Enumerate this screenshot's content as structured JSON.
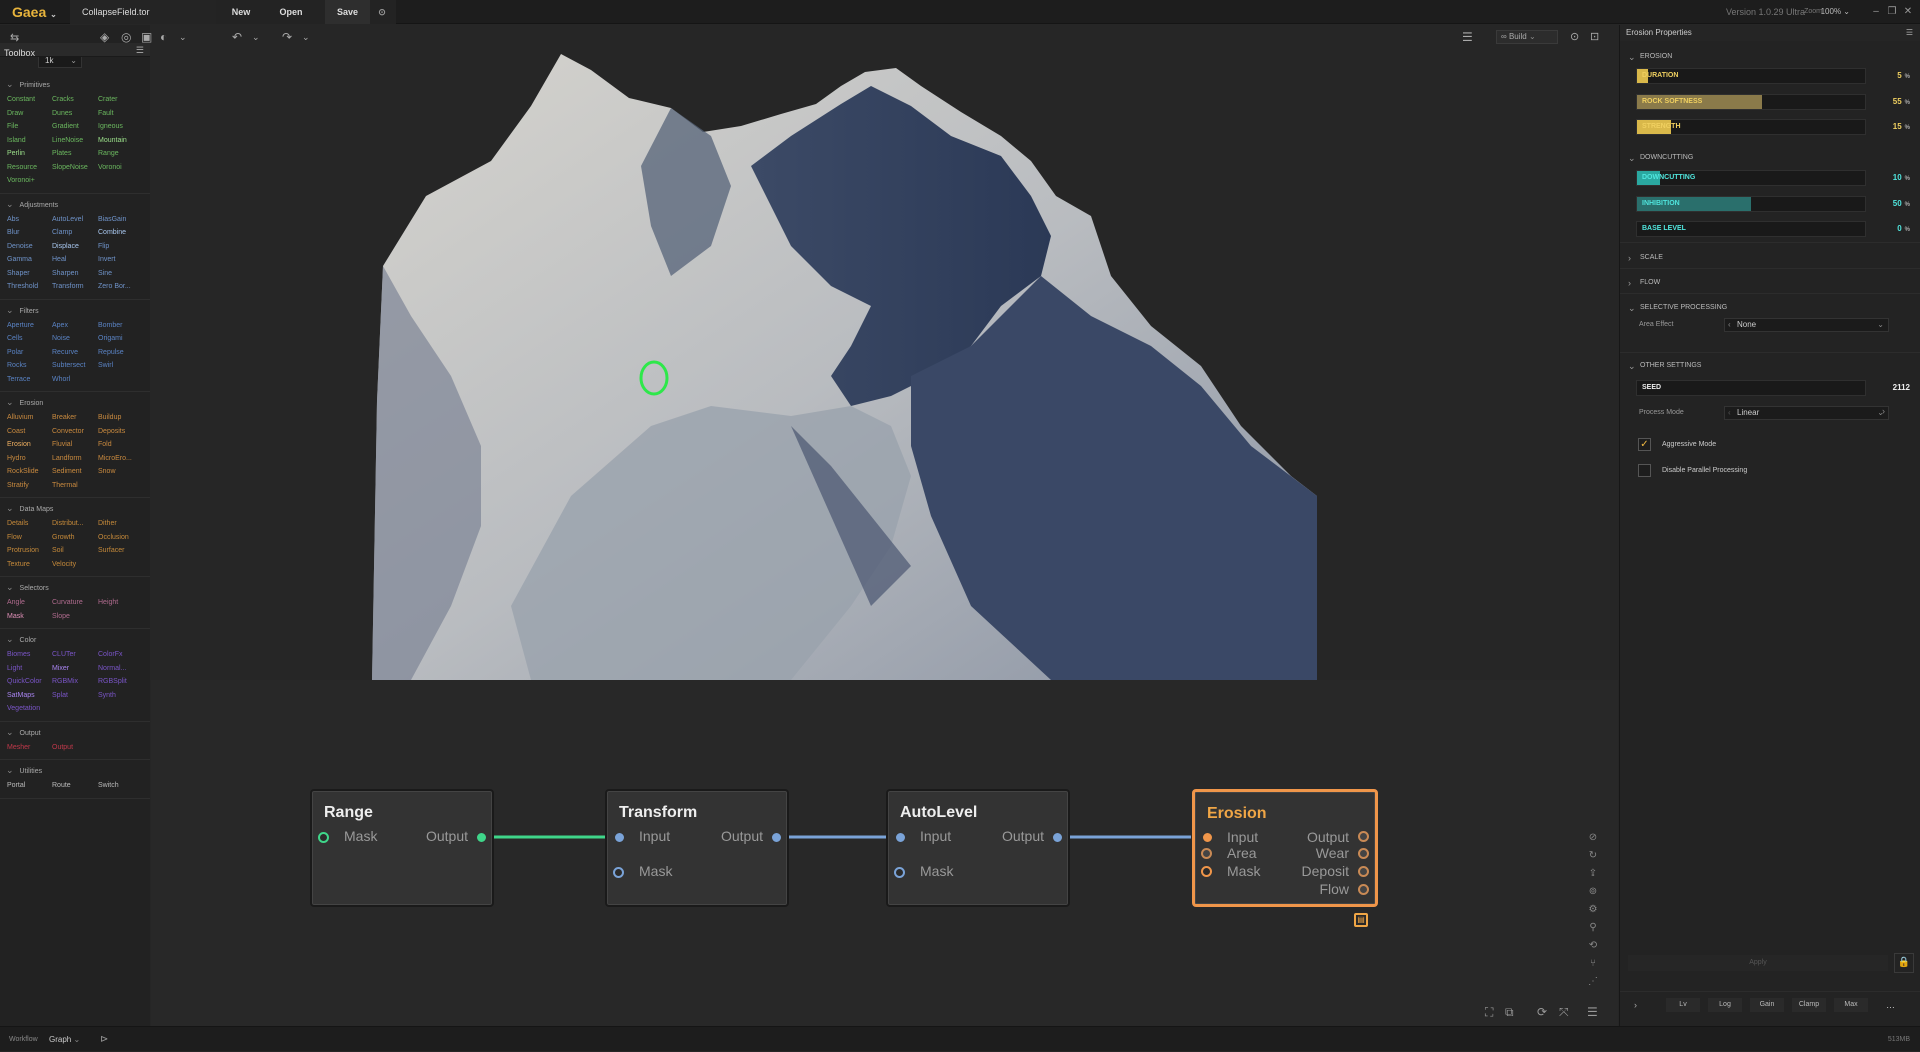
{
  "title_bar": {
    "app_name": "Gaea",
    "file_name": "CollapseField.tor",
    "menu": [
      "New",
      "Open",
      "Save"
    ],
    "version": "Version 1.0.29 Ultra",
    "zoom_label": "Zoom",
    "zoom_value": "100%"
  },
  "viewport_toolbar": {
    "resolution": "1k",
    "build_label": "Build"
  },
  "toolbox": {
    "title": "Toolbox",
    "sections": [
      {
        "name": "Primitives",
        "items": [
          {
            "label": "Constant",
            "color": "#6bb85f"
          },
          {
            "label": "Cracks",
            "color": "#6bb85f"
          },
          {
            "label": "Crater",
            "color": "#6bb85f"
          },
          {
            "label": "Draw",
            "color": "#6bb85f"
          },
          {
            "label": "Dunes",
            "color": "#6bb85f"
          },
          {
            "label": "Fault",
            "color": "#6bb85f"
          },
          {
            "label": "File",
            "color": "#6bb85f"
          },
          {
            "label": "Gradient",
            "color": "#6bb85f"
          },
          {
            "label": "Igneous",
            "color": "#6bb85f"
          },
          {
            "label": "Island",
            "color": "#6bb85f"
          },
          {
            "label": "LineNoise",
            "color": "#6bb85f"
          },
          {
            "label": "Mountain",
            "color": "#9be08a"
          },
          {
            "label": "Perlin",
            "color": "#9be08a"
          },
          {
            "label": "Plates",
            "color": "#6bb85f"
          },
          {
            "label": "Range",
            "color": "#6bb85f"
          },
          {
            "label": "Resource",
            "color": "#6bb85f"
          },
          {
            "label": "SlopeNoise",
            "color": "#6bb85f"
          },
          {
            "label": "Voronoi",
            "color": "#6bb85f"
          },
          {
            "label": "Voronoi+",
            "color": "#6bb85f"
          }
        ]
      },
      {
        "name": "Adjustments",
        "items": [
          {
            "label": "Abs",
            "color": "#6f93c9"
          },
          {
            "label": "AutoLevel",
            "color": "#6f93c9"
          },
          {
            "label": "BiasGain",
            "color": "#6f93c9"
          },
          {
            "label": "Blur",
            "color": "#6f93c9"
          },
          {
            "label": "Clamp",
            "color": "#6f93c9"
          },
          {
            "label": "Combine",
            "color": "#a9c8f0"
          },
          {
            "label": "Denoise",
            "color": "#6f93c9"
          },
          {
            "label": "Displace",
            "color": "#a9c8f0"
          },
          {
            "label": "Flip",
            "color": "#6f93c9"
          },
          {
            "label": "Gamma",
            "color": "#6f93c9"
          },
          {
            "label": "Heal",
            "color": "#6f93c9"
          },
          {
            "label": "Invert",
            "color": "#6f93c9"
          },
          {
            "label": "Shaper",
            "color": "#6f93c9"
          },
          {
            "label": "Sharpen",
            "color": "#6f93c9"
          },
          {
            "label": "Sine",
            "color": "#6f93c9"
          },
          {
            "label": "Threshold",
            "color": "#6f93c9"
          },
          {
            "label": "Transform",
            "color": "#6f93c9"
          },
          {
            "label": "Zero Bor...",
            "color": "#6f93c9"
          }
        ]
      },
      {
        "name": "Filters",
        "items": [
          {
            "label": "Aperture",
            "color": "#5a83c4"
          },
          {
            "label": "Apex",
            "color": "#5a83c4"
          },
          {
            "label": "Bomber",
            "color": "#5a83c4"
          },
          {
            "label": "Cells",
            "color": "#5a83c4"
          },
          {
            "label": "Noise",
            "color": "#5a83c4"
          },
          {
            "label": "Origami",
            "color": "#5a83c4"
          },
          {
            "label": "Polar",
            "color": "#5a83c4"
          },
          {
            "label": "Recurve",
            "color": "#5a83c4"
          },
          {
            "label": "Repulse",
            "color": "#5a83c4"
          },
          {
            "label": "Rocks",
            "color": "#5a83c4"
          },
          {
            "label": "Subtersect",
            "color": "#5a83c4"
          },
          {
            "label": "Swirl",
            "color": "#5a83c4"
          },
          {
            "label": "Terrace",
            "color": "#5a83c4"
          },
          {
            "label": "Whorl",
            "color": "#5a83c4"
          }
        ]
      },
      {
        "name": "Erosion",
        "items": [
          {
            "label": "Alluvium",
            "color": "#c98a3f"
          },
          {
            "label": "Breaker",
            "color": "#c98a3f"
          },
          {
            "label": "Buildup",
            "color": "#c98a3f"
          },
          {
            "label": "Coast",
            "color": "#c98a3f"
          },
          {
            "label": "Convector",
            "color": "#c98a3f"
          },
          {
            "label": "Deposits",
            "color": "#c98a3f"
          },
          {
            "label": "Erosion",
            "color": "#f0b060"
          },
          {
            "label": "Fluvial",
            "color": "#c98a3f"
          },
          {
            "label": "Fold",
            "color": "#c98a3f"
          },
          {
            "label": "Hydro",
            "color": "#c98a3f"
          },
          {
            "label": "Landform",
            "color": "#c98a3f"
          },
          {
            "label": "MicroEro...",
            "color": "#c98a3f"
          },
          {
            "label": "RockSlide",
            "color": "#c98a3f"
          },
          {
            "label": "Sediment",
            "color": "#c98a3f"
          },
          {
            "label": "Snow",
            "color": "#c98a3f"
          },
          {
            "label": "Stratify",
            "color": "#c98a3f"
          },
          {
            "label": "Thermal",
            "color": "#c98a3f"
          }
        ]
      },
      {
        "name": "Data Maps",
        "items": [
          {
            "label": "Details",
            "color": "#c68a3a"
          },
          {
            "label": "Distribut...",
            "color": "#c68a3a"
          },
          {
            "label": "Dither",
            "color": "#c68a3a"
          },
          {
            "label": "Flow",
            "color": "#c68a3a"
          },
          {
            "label": "Growth",
            "color": "#c68a3a"
          },
          {
            "label": "Occlusion",
            "color": "#c68a3a"
          },
          {
            "label": "Protrusion",
            "color": "#c68a3a"
          },
          {
            "label": "Soil",
            "color": "#c68a3a"
          },
          {
            "label": "Surfacer",
            "color": "#c68a3a"
          },
          {
            "label": "Texture",
            "color": "#c68a3a"
          },
          {
            "label": "Velocity",
            "color": "#c68a3a"
          }
        ]
      },
      {
        "name": "Selectors",
        "items": [
          {
            "label": "Angle",
            "color": "#b06b8e"
          },
          {
            "label": "Curvature",
            "color": "#b06b8e"
          },
          {
            "label": "Height",
            "color": "#b06b8e"
          },
          {
            "label": "Mask",
            "color": "#e090b8"
          },
          {
            "label": "Slope",
            "color": "#b06b8e"
          }
        ]
      },
      {
        "name": "Color",
        "items": [
          {
            "label": "Biomes",
            "color": "#7a55c8"
          },
          {
            "label": "CLUTer",
            "color": "#7a55c8"
          },
          {
            "label": "ColorFx",
            "color": "#7a55c8"
          },
          {
            "label": "Light",
            "color": "#7a55c8"
          },
          {
            "label": "Mixer",
            "color": "#a884f0"
          },
          {
            "label": "Normal...",
            "color": "#7a55c8"
          },
          {
            "label": "QuickColor",
            "color": "#7a55c8"
          },
          {
            "label": "RGBMix",
            "color": "#7a55c8"
          },
          {
            "label": "RGBSplit",
            "color": "#7a55c8"
          },
          {
            "label": "SatMaps",
            "color": "#a884f0"
          },
          {
            "label": "Splat",
            "color": "#7a55c8"
          },
          {
            "label": "Synth",
            "color": "#7a55c8"
          },
          {
            "label": "Vegetation",
            "color": "#7a55c8"
          }
        ]
      },
      {
        "name": "Output",
        "items": [
          {
            "label": "Mesher",
            "color": "#c0384a"
          },
          {
            "label": "Output",
            "color": "#c0384a"
          }
        ]
      },
      {
        "name": "Utilities",
        "items": [
          {
            "label": "Portal",
            "color": "#bbbbbb"
          },
          {
            "label": "Route",
            "color": "#bbbbbb"
          },
          {
            "label": "Switch",
            "color": "#bbbbbb"
          }
        ]
      }
    ]
  },
  "graph": {
    "nodes": [
      {
        "title": "Range",
        "inputs": [
          "Mask"
        ],
        "outputs": [
          "Output"
        ]
      },
      {
        "title": "Transform",
        "inputs": [
          "Input",
          "Mask"
        ],
        "outputs": [
          "Output"
        ]
      },
      {
        "title": "AutoLevel",
        "inputs": [
          "Input",
          "Mask"
        ],
        "outputs": [
          "Output"
        ]
      },
      {
        "title": "Erosion",
        "inputs": [
          "Input",
          "Area",
          "Mask"
        ],
        "outputs": [
          "Output",
          "Wear",
          "Deposit",
          "Flow"
        ]
      }
    ]
  },
  "properties": {
    "title": "Erosion Properties",
    "groups": {
      "erosion": "EROSION",
      "downcutting": "DOWNCUTTING",
      "scale": "SCALE",
      "flow": "FLOW",
      "selective": "SELECTIVE PROCESSING",
      "other": "OTHER SETTINGS"
    },
    "sliders": [
      {
        "label": "DURATION",
        "value": "5",
        "unit": "%",
        "fraction": 0.05,
        "color": "#d9b84a",
        "text_color": "#f0d060"
      },
      {
        "label": "ROCK SOFTNESS",
        "value": "55",
        "unit": "%",
        "fraction": 0.55,
        "color": "#8a7a4a",
        "text_color": "#f0d060"
      },
      {
        "label": "STRENGTH",
        "value": "15",
        "unit": "%",
        "fraction": 0.15,
        "color": "#d9b84a",
        "text_color": "#f0d060"
      },
      {
        "label": "DOWNCUTTING",
        "value": "10",
        "unit": "%",
        "fraction": 0.1,
        "color": "#2aa8a0",
        "text_color": "#50e6de"
      },
      {
        "label": "INHIBITION",
        "value": "50",
        "unit": "%",
        "fraction": 0.5,
        "color": "#2a6f6c",
        "text_color": "#50e6de"
      },
      {
        "label": "BASE LEVEL",
        "value": "0",
        "unit": "%",
        "fraction": 0.0,
        "color": "#2aa8a0",
        "text_color": "#50e6de"
      }
    ],
    "area_effect_label": "Area Effect",
    "area_effect_value": "None",
    "seed_label": "SEED",
    "seed_value": "2112",
    "process_mode_label": "Process Mode",
    "process_mode_value": "Linear",
    "aggressive_mode": {
      "label": "Aggressive Mode",
      "checked": true
    },
    "disable_parallel": {
      "label": "Disable Parallel Processing",
      "checked": false
    },
    "apply_label": "Apply",
    "bottom_tabs": [
      "Lv",
      "Log",
      "Gain",
      "Clamp",
      "Max"
    ]
  },
  "status_bar": {
    "workflow_label": "Workflow",
    "workflow_value": "Graph",
    "memory": "513MB"
  }
}
